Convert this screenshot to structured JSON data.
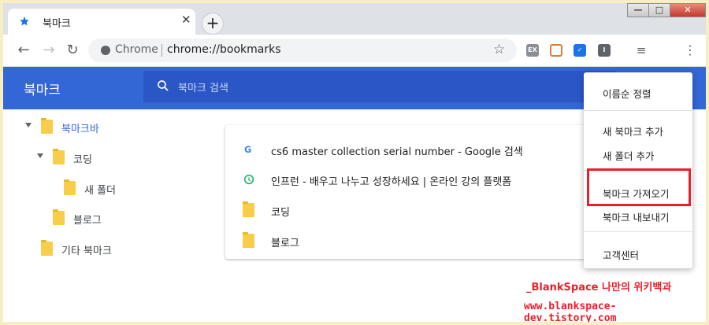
{
  "tab": {
    "title": "북마크",
    "close": "✕"
  },
  "new_tab": "+",
  "window_controls": {
    "minimize": "—",
    "maximize": "□",
    "close": "✕"
  },
  "nav": {
    "back": "←",
    "forward": "→",
    "reload": "↻"
  },
  "omnibox": {
    "site_label": "Chrome",
    "url": "chrome://bookmarks",
    "star": "☆"
  },
  "extensions": [
    {
      "name": "ext-ex",
      "text": "EX",
      "color": "#8a8f96"
    },
    {
      "name": "ext-cast",
      "text": "",
      "color": "#e07b39"
    },
    {
      "name": "ext-check",
      "text": "✓",
      "color": "#1a73e8"
    },
    {
      "name": "ext-i",
      "text": "I",
      "color": "#5f6368"
    }
  ],
  "header": {
    "title": "북마크",
    "search_placeholder": "북마크 검색"
  },
  "tree": [
    {
      "label": "북마크바",
      "selected": true
    },
    {
      "label": "코딩"
    },
    {
      "label": "새 폴더"
    },
    {
      "label": "블로그"
    },
    {
      "label": "기타 북마크"
    }
  ],
  "list": [
    {
      "label": "cs6 master collection serial number - Google 검색",
      "icon": "google-icon"
    },
    {
      "label": "인프런 - 배우고 나누고 성장하세요 | 온라인 강의 플랫폼",
      "icon": "inflearn-icon"
    },
    {
      "label": "코딩",
      "icon": "folder-icon"
    },
    {
      "label": "블로그",
      "icon": "folder-icon"
    }
  ],
  "menu": {
    "sort": "이름순 정렬",
    "add_bookmark": "새 북마크 추가",
    "add_folder": "새 폴더 추가",
    "import": "북마크 가져오기",
    "export": "북마크 내보내기",
    "help": "고객센터"
  },
  "watermark": {
    "line1": "_BlankSpace 나만의 위키백과",
    "line2": "www.blankspace-dev.tistory.com"
  },
  "colors": {
    "header_blue": "#3367d6",
    "highlight_red": "#e8202a",
    "folder_yellow": "#f7cd4a"
  }
}
